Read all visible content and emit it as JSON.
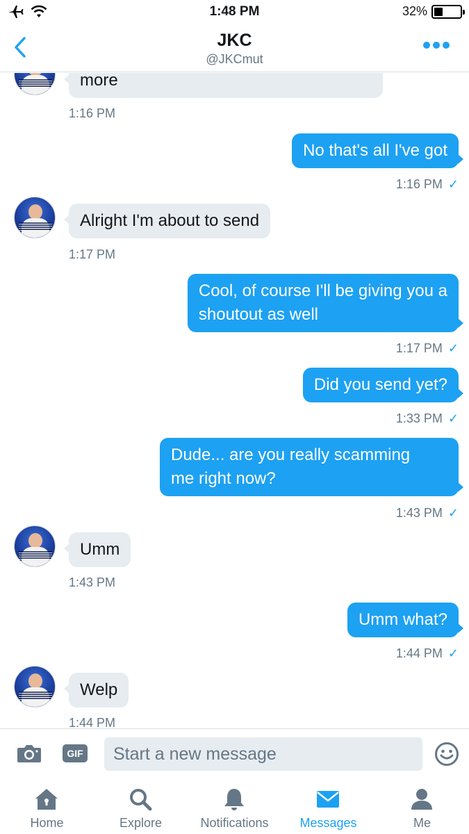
{
  "status_bar": {
    "time": "1:48 PM",
    "battery_percent": "32%",
    "battery_level": 0.32,
    "icons": [
      "airplane-icon",
      "wifi-icon",
      "battery-icon"
    ]
  },
  "header": {
    "title": "JKC",
    "handle": "@JKCmut",
    "back_icon": "chevron-left-icon",
    "more_icon": "more-dots-icon",
    "accent_color": "#1da1f2"
  },
  "messages": [
    {
      "side": "in",
      "text": "more",
      "time": "1:16 PM"
    },
    {
      "side": "out",
      "text": "No that's all I've got",
      "time": "1:16 PM",
      "check": "✓"
    },
    {
      "side": "in",
      "text": "Alright I'm about to send",
      "time": "1:17 PM"
    },
    {
      "side": "out",
      "text_lines": [
        "Cool, of course I'll be giving you a",
        "shoutout as well"
      ],
      "time": "1:17 PM",
      "check": "✓"
    },
    {
      "side": "out",
      "text": "Did you send yet?",
      "time": "1:33 PM",
      "check": "✓"
    },
    {
      "side": "out",
      "text_lines": [
        "Dude... are you really scamming",
        "me right now?"
      ],
      "time": "1:43 PM",
      "check": "✓"
    },
    {
      "side": "in",
      "text": "Umm",
      "time": "1:43 PM"
    },
    {
      "side": "out",
      "text": "Umm what?",
      "time": "1:44 PM",
      "check": "✓"
    },
    {
      "side": "in",
      "text": "Welp",
      "time": "1:44 PM"
    }
  ],
  "composer": {
    "gif_label": "GIF",
    "placeholder": "Start a new message",
    "camera_icon": "camera-icon",
    "emoji_icon": "smiley-icon"
  },
  "tabs": [
    {
      "label": "Home",
      "icon": "home-icon",
      "active": false
    },
    {
      "label": "Explore",
      "icon": "search-icon",
      "active": false
    },
    {
      "label": "Notifications",
      "icon": "bell-icon",
      "active": false
    },
    {
      "label": "Messages",
      "icon": "envelope-icon",
      "active": true
    },
    {
      "label": "Me",
      "icon": "person-icon",
      "active": false
    }
  ]
}
